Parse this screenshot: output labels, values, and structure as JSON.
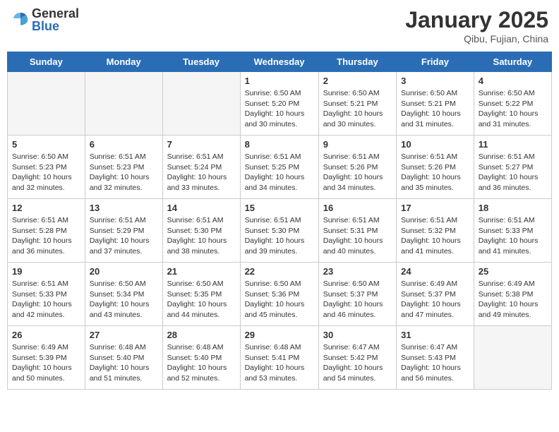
{
  "header": {
    "logo_general": "General",
    "logo_blue": "Blue",
    "title": "January 2025",
    "location": "Qibu, Fujian, China"
  },
  "days_of_week": [
    "Sunday",
    "Monday",
    "Tuesday",
    "Wednesday",
    "Thursday",
    "Friday",
    "Saturday"
  ],
  "weeks": [
    {
      "days": [
        {
          "num": "",
          "info": "",
          "empty": true
        },
        {
          "num": "",
          "info": "",
          "empty": true
        },
        {
          "num": "",
          "info": "",
          "empty": true
        },
        {
          "num": "1",
          "info": "Sunrise: 6:50 AM\nSunset: 5:20 PM\nDaylight: 10 hours\nand 30 minutes.",
          "empty": false
        },
        {
          "num": "2",
          "info": "Sunrise: 6:50 AM\nSunset: 5:21 PM\nDaylight: 10 hours\nand 30 minutes.",
          "empty": false
        },
        {
          "num": "3",
          "info": "Sunrise: 6:50 AM\nSunset: 5:21 PM\nDaylight: 10 hours\nand 31 minutes.",
          "empty": false
        },
        {
          "num": "4",
          "info": "Sunrise: 6:50 AM\nSunset: 5:22 PM\nDaylight: 10 hours\nand 31 minutes.",
          "empty": false
        }
      ]
    },
    {
      "days": [
        {
          "num": "5",
          "info": "Sunrise: 6:50 AM\nSunset: 5:23 PM\nDaylight: 10 hours\nand 32 minutes.",
          "empty": false
        },
        {
          "num": "6",
          "info": "Sunrise: 6:51 AM\nSunset: 5:23 PM\nDaylight: 10 hours\nand 32 minutes.",
          "empty": false
        },
        {
          "num": "7",
          "info": "Sunrise: 6:51 AM\nSunset: 5:24 PM\nDaylight: 10 hours\nand 33 minutes.",
          "empty": false
        },
        {
          "num": "8",
          "info": "Sunrise: 6:51 AM\nSunset: 5:25 PM\nDaylight: 10 hours\nand 34 minutes.",
          "empty": false
        },
        {
          "num": "9",
          "info": "Sunrise: 6:51 AM\nSunset: 5:26 PM\nDaylight: 10 hours\nand 34 minutes.",
          "empty": false
        },
        {
          "num": "10",
          "info": "Sunrise: 6:51 AM\nSunset: 5:26 PM\nDaylight: 10 hours\nand 35 minutes.",
          "empty": false
        },
        {
          "num": "11",
          "info": "Sunrise: 6:51 AM\nSunset: 5:27 PM\nDaylight: 10 hours\nand 36 minutes.",
          "empty": false
        }
      ]
    },
    {
      "days": [
        {
          "num": "12",
          "info": "Sunrise: 6:51 AM\nSunset: 5:28 PM\nDaylight: 10 hours\nand 36 minutes.",
          "empty": false
        },
        {
          "num": "13",
          "info": "Sunrise: 6:51 AM\nSunset: 5:29 PM\nDaylight: 10 hours\nand 37 minutes.",
          "empty": false
        },
        {
          "num": "14",
          "info": "Sunrise: 6:51 AM\nSunset: 5:30 PM\nDaylight: 10 hours\nand 38 minutes.",
          "empty": false
        },
        {
          "num": "15",
          "info": "Sunrise: 6:51 AM\nSunset: 5:30 PM\nDaylight: 10 hours\nand 39 minutes.",
          "empty": false
        },
        {
          "num": "16",
          "info": "Sunrise: 6:51 AM\nSunset: 5:31 PM\nDaylight: 10 hours\nand 40 minutes.",
          "empty": false
        },
        {
          "num": "17",
          "info": "Sunrise: 6:51 AM\nSunset: 5:32 PM\nDaylight: 10 hours\nand 41 minutes.",
          "empty": false
        },
        {
          "num": "18",
          "info": "Sunrise: 6:51 AM\nSunset: 5:33 PM\nDaylight: 10 hours\nand 41 minutes.",
          "empty": false
        }
      ]
    },
    {
      "days": [
        {
          "num": "19",
          "info": "Sunrise: 6:51 AM\nSunset: 5:33 PM\nDaylight: 10 hours\nand 42 minutes.",
          "empty": false
        },
        {
          "num": "20",
          "info": "Sunrise: 6:50 AM\nSunset: 5:34 PM\nDaylight: 10 hours\nand 43 minutes.",
          "empty": false
        },
        {
          "num": "21",
          "info": "Sunrise: 6:50 AM\nSunset: 5:35 PM\nDaylight: 10 hours\nand 44 minutes.",
          "empty": false
        },
        {
          "num": "22",
          "info": "Sunrise: 6:50 AM\nSunset: 5:36 PM\nDaylight: 10 hours\nand 45 minutes.",
          "empty": false
        },
        {
          "num": "23",
          "info": "Sunrise: 6:50 AM\nSunset: 5:37 PM\nDaylight: 10 hours\nand 46 minutes.",
          "empty": false
        },
        {
          "num": "24",
          "info": "Sunrise: 6:49 AM\nSunset: 5:37 PM\nDaylight: 10 hours\nand 47 minutes.",
          "empty": false
        },
        {
          "num": "25",
          "info": "Sunrise: 6:49 AM\nSunset: 5:38 PM\nDaylight: 10 hours\nand 49 minutes.",
          "empty": false
        }
      ]
    },
    {
      "days": [
        {
          "num": "26",
          "info": "Sunrise: 6:49 AM\nSunset: 5:39 PM\nDaylight: 10 hours\nand 50 minutes.",
          "empty": false
        },
        {
          "num": "27",
          "info": "Sunrise: 6:48 AM\nSunset: 5:40 PM\nDaylight: 10 hours\nand 51 minutes.",
          "empty": false
        },
        {
          "num": "28",
          "info": "Sunrise: 6:48 AM\nSunset: 5:40 PM\nDaylight: 10 hours\nand 52 minutes.",
          "empty": false
        },
        {
          "num": "29",
          "info": "Sunrise: 6:48 AM\nSunset: 5:41 PM\nDaylight: 10 hours\nand 53 minutes.",
          "empty": false
        },
        {
          "num": "30",
          "info": "Sunrise: 6:47 AM\nSunset: 5:42 PM\nDaylight: 10 hours\nand 54 minutes.",
          "empty": false
        },
        {
          "num": "31",
          "info": "Sunrise: 6:47 AM\nSunset: 5:43 PM\nDaylight: 10 hours\nand 56 minutes.",
          "empty": false
        },
        {
          "num": "",
          "info": "",
          "empty": true
        }
      ]
    }
  ]
}
